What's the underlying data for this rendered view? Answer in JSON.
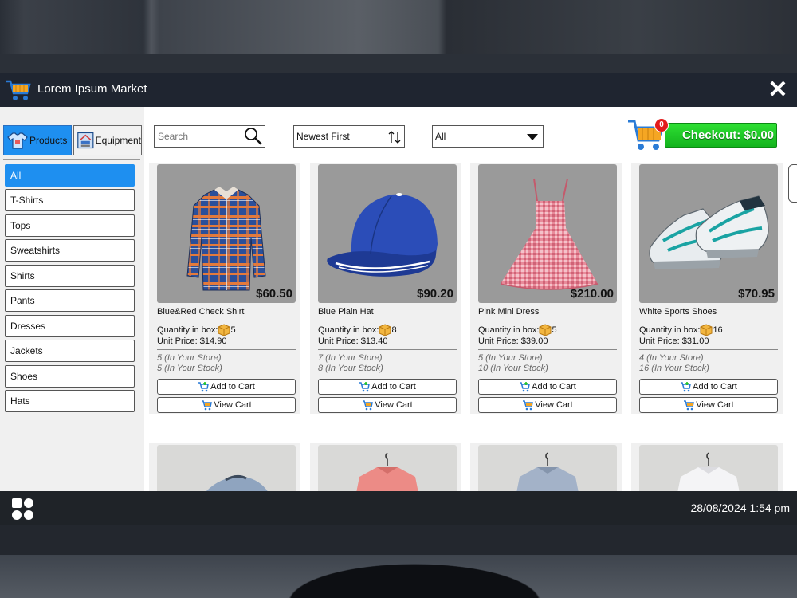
{
  "app": {
    "title": "Lorem Ipsum Market",
    "icons": {
      "logo": "shopping-cart-icon",
      "close": "close-icon"
    },
    "colors": {
      "accent": "#1e8ff0",
      "checkout": "#1cc425",
      "titlebar": "#1f2530"
    }
  },
  "sidebar": {
    "tabs": [
      {
        "label": "Products",
        "active": true,
        "icon": "tshirt-icon"
      },
      {
        "label": "Equipment",
        "active": false,
        "icon": "equipment-icon"
      }
    ],
    "categories": [
      {
        "label": "All",
        "active": true
      },
      {
        "label": "T-Shirts"
      },
      {
        "label": "Tops"
      },
      {
        "label": "Sweatshirts"
      },
      {
        "label": "Shirts"
      },
      {
        "label": "Pants"
      },
      {
        "label": "Dresses"
      },
      {
        "label": "Jackets"
      },
      {
        "label": "Shoes"
      },
      {
        "label": "Hats"
      }
    ]
  },
  "toolbar": {
    "search_placeholder": "Search",
    "search_value": "",
    "sort_selected": "Newest First",
    "filter_selected": "All",
    "checkout_label": "Checkout: $0.00",
    "cart_count": "0"
  },
  "products": [
    {
      "name": "Blue&Red Check Shirt",
      "price": "$60.50",
      "qty_label": "Quantity in box:",
      "qty": "5",
      "unit_price": "Unit Price: $14.90",
      "store": "5 (In Your Store)",
      "stock": "5 (In Your Stock)",
      "add_label": "Add to Cart",
      "view_label": "View Cart",
      "image": "check-shirt-image"
    },
    {
      "name": "Blue Plain Hat",
      "price": "$90.20",
      "qty_label": "Quantity in box:",
      "qty": "8",
      "unit_price": "Unit Price: $13.40",
      "store": "7 (In Your Store)",
      "stock": "8 (In Your Stock)",
      "add_label": "Add to Cart",
      "view_label": "View Cart",
      "image": "cap-image"
    },
    {
      "name": "Pink Mini Dress",
      "price": "$210.00",
      "qty_label": "Quantity in box:",
      "qty": "5",
      "unit_price": "Unit Price: $39.00",
      "store": "5 (In Your Store)",
      "stock": "10 (In Your Stock)",
      "add_label": "Add to Cart",
      "view_label": "View Cart",
      "image": "dress-image"
    },
    {
      "name": "White Sports Shoes",
      "price": "$70.95",
      "qty_label": "Quantity in box:",
      "qty": "16",
      "unit_price": "Unit Price: $31.00",
      "store": "4 (In Your Store)",
      "stock": "16 (In Your Stock)",
      "add_label": "Add to Cart",
      "view_label": "View Cart",
      "image": "sneakers-image"
    }
  ],
  "taskbar": {
    "apps_icon": "apps-grid-icon",
    "clock": "28/08/2024 1:54 pm"
  }
}
